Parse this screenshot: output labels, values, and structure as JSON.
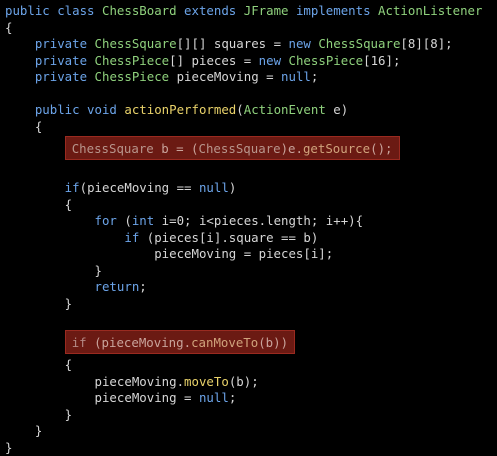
{
  "colors": {
    "background": "#000000",
    "keyword": "#6ca4e9",
    "type": "#8fd17d",
    "method": "#e9d26a",
    "identifier": "#d6d6d6",
    "highlight": "#6b1a13"
  },
  "code": {
    "l1": {
      "a": "public class ",
      "b": "ChessBoard",
      "c": " extends ",
      "d": "JFrame",
      "e": " implements ",
      "f": "ActionListener"
    },
    "l2": "{",
    "l3": {
      "a": "    private ",
      "b": "ChessSquare",
      "c": "[][] squares = ",
      "d": "new ",
      "e": "ChessSquare",
      "f": "[8][8];"
    },
    "l4": {
      "a": "    private ",
      "b": "ChessPiece",
      "c": "[] pieces = ",
      "d": "new ",
      "e": "ChessPiece",
      "f": "[16];"
    },
    "l5": {
      "a": "    private ",
      "b": "ChessPiece",
      "c": " pieceMoving = ",
      "d": "null",
      "e": ";"
    },
    "l7": {
      "a": "    public void ",
      "b": "actionPerformed",
      "c": "(",
      "d": "ActionEvent",
      "e": " e)"
    },
    "l8": "    {",
    "l9": {
      "a": "ChessSquare",
      "b": " b = (",
      "c": "ChessSquare",
      "d": ")e.",
      "e": "getSource",
      "f": "();"
    },
    "l11": {
      "a": "        if",
      "b": "(pieceMoving == ",
      "c": "null",
      "d": ")"
    },
    "l12": "        {",
    "l13": {
      "a": "            for ",
      "b": "(",
      "c": "int",
      "d": " i=0; i<pieces.length; i++){"
    },
    "l14": {
      "a": "                if ",
      "b": "(pieces[i].square == b)"
    },
    "l15": "                    pieceMoving = pieces[i];",
    "l16": "            }",
    "l17": {
      "a": "            return",
      "b": ";"
    },
    "l18": "        }",
    "l20": {
      "a": "if ",
      "b": "(pieceMoving.",
      "c": "canMoveTo",
      "d": "(b))"
    },
    "l21": "        {",
    "l22": {
      "a": "            pieceMoving.",
      "b": "moveTo",
      "c": "(b);"
    },
    "l23": {
      "a": "            pieceMoving = ",
      "b": "null",
      "c": ";"
    },
    "l24": "        }",
    "l25": "    }",
    "l26": "}"
  }
}
